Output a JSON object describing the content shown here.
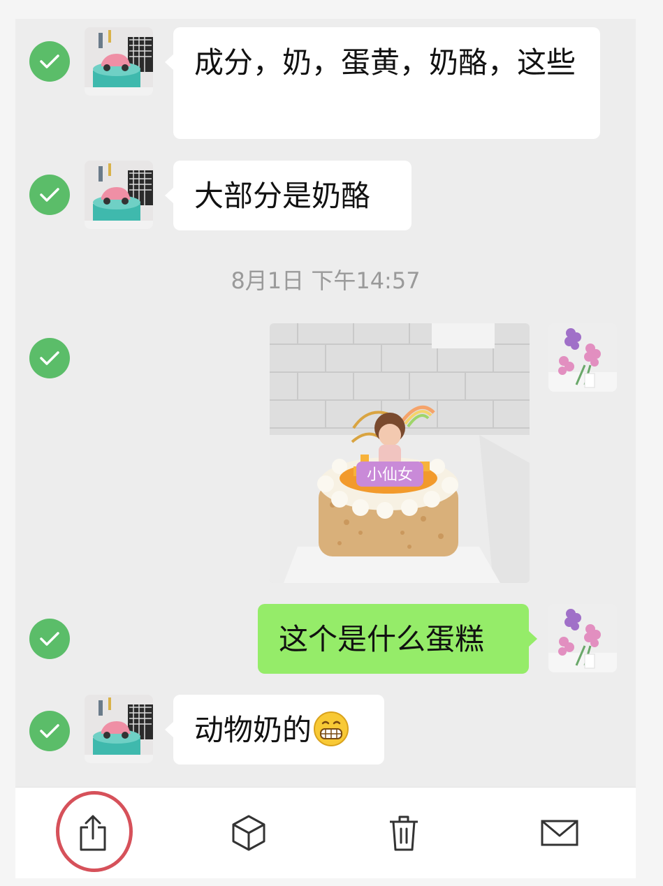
{
  "messages": [
    {
      "side": "in",
      "text": "成分，奶，蛋黄，奶酪，这些"
    },
    {
      "side": "in",
      "text": "大部分是奶酪"
    },
    {
      "side": "out",
      "type": "image",
      "image": "birthday-cake-photo"
    },
    {
      "side": "out",
      "text": "这个是什么蛋糕"
    },
    {
      "side": "in",
      "text": "动物奶的",
      "emoji": "grinning-face-emoji"
    }
  ],
  "timestamp": "8月1日 下午14:57",
  "photo": {
    "topper_text": "小仙女"
  },
  "toolbar": {
    "actions": [
      {
        "name": "share",
        "icon": "share-icon"
      },
      {
        "name": "favorite",
        "icon": "cube-icon"
      },
      {
        "name": "delete",
        "icon": "trash-icon"
      },
      {
        "name": "mail",
        "icon": "mail-icon"
      }
    ]
  },
  "colors": {
    "check": "#5bbd69",
    "outgoing_bubble": "#95ec69",
    "incoming_bubble": "#ffffff",
    "highlight_ring": "#d6515a"
  }
}
